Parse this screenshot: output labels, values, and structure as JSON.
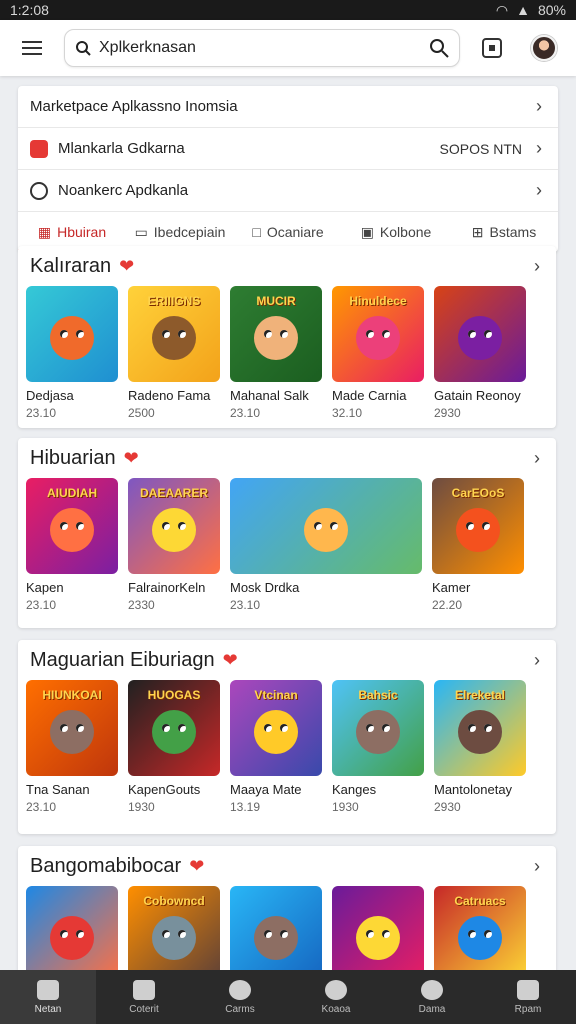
{
  "status": {
    "time": "1:2:08",
    "battery": "80%"
  },
  "search": {
    "value": "Xplkerknasan"
  },
  "menu": [
    {
      "label": "Marketpace Aplkassno Inomsia",
      "meta": ""
    },
    {
      "label": "Mlankarla Gdkarna",
      "meta": "SOPOS NTN"
    },
    {
      "label": "Noankerc Apdkanla",
      "meta": ""
    }
  ],
  "tabs": [
    "Hbuiran",
    "Ibedcepiain",
    "Ocaniare",
    "Kolbone",
    "Bstams"
  ],
  "sections": [
    {
      "title": "Kalıraran",
      "apps": [
        {
          "name": "Dedjasa",
          "size": "23.10",
          "colors": [
            "#35c9d6",
            "#1f8fd1"
          ],
          "face": "#f06a2b",
          "banner": ""
        },
        {
          "name": "Radeno Fama",
          "size": "2500",
          "colors": [
            "#ffd23a",
            "#f3a21a"
          ],
          "face": "#8d5a2b",
          "banner": "ERIIIGNS"
        },
        {
          "name": "Mahanal Salk",
          "size": "23.10",
          "colors": [
            "#2e7d32",
            "#1b5e20"
          ],
          "face": "#f0b27a",
          "banner": "MUCIR"
        },
        {
          "name": "Made Carnia",
          "size": "32.10",
          "colors": [
            "#ff9800",
            "#e91e63"
          ],
          "face": "#ec407a",
          "banner": "Hinuldece"
        },
        {
          "name": "Gatain Reonoy",
          "size": "2930",
          "colors": [
            "#d84315",
            "#6a1b9a"
          ],
          "face": "#7b1fa2",
          "banner": ""
        }
      ]
    },
    {
      "title": "Hibuarian",
      "apps": [
        {
          "name": "Kapen",
          "size": "23.10",
          "colors": [
            "#e91e63",
            "#7b1fa2"
          ],
          "face": "#ff7043",
          "banner": "AIUDIAH"
        },
        {
          "name": "FalrainorKeln",
          "size": "2330",
          "colors": [
            "#7e57c2",
            "#ff7043"
          ],
          "face": "#fdd835",
          "banner": "DAEAARER"
        },
        {
          "name": "Mosk Drdka",
          "size": "23.10",
          "colors": [
            "#42a5f5",
            "#66bb6a"
          ],
          "face": "#ffb74d",
          "banner": "",
          "wide": true
        },
        {
          "name": "Kamer",
          "size": "22.20",
          "colors": [
            "#6d4c41",
            "#ff8f00"
          ],
          "face": "#f4511e",
          "banner": "CarEOoS"
        }
      ]
    },
    {
      "title": "Maguarian Eiburiagn",
      "apps": [
        {
          "name": "Tna Sanan",
          "size": "23.10",
          "colors": [
            "#ff6f00",
            "#bf360c"
          ],
          "face": "#8d6e63",
          "banner": "HIUNKOAI"
        },
        {
          "name": "KapenGouts",
          "size": "1930",
          "colors": [
            "#212121",
            "#c62828"
          ],
          "face": "#43a047",
          "banner": "HUOGAS"
        },
        {
          "name": "Maaya Mate",
          "size": "13.19",
          "colors": [
            "#ab47bc",
            "#3949ab"
          ],
          "face": "#ffca28",
          "banner": "Vtcinan"
        },
        {
          "name": "Kanges",
          "size": "1930",
          "colors": [
            "#4fc3f7",
            "#43a047"
          ],
          "face": "#8d6e63",
          "banner": "Bahsic"
        },
        {
          "name": "Mantolonetay",
          "size": "2930",
          "colors": [
            "#29b6f6",
            "#ffca28"
          ],
          "face": "#6d4c41",
          "banner": "Elreketal"
        }
      ]
    },
    {
      "title": "Bangomabibocar",
      "apps": [
        {
          "name": "",
          "size": "",
          "colors": [
            "#1e88e5",
            "#ff7043"
          ],
          "face": "#e53935",
          "banner": ""
        },
        {
          "name": "",
          "size": "",
          "colors": [
            "#ff8f00",
            "#5d4037"
          ],
          "face": "#78909c",
          "banner": "Cobowncd"
        },
        {
          "name": "",
          "size": "",
          "colors": [
            "#29b6f6",
            "#1565c0"
          ],
          "face": "#8d6e63",
          "banner": ""
        },
        {
          "name": "",
          "size": "",
          "colors": [
            "#6a1b9a",
            "#e91e63"
          ],
          "face": "#fdd835",
          "banner": ""
        },
        {
          "name": "",
          "size": "",
          "colors": [
            "#c62828",
            "#fdd835"
          ],
          "face": "#1e88e5",
          "banner": "Catruacs"
        }
      ]
    }
  ],
  "bottom_nav": [
    "Netan",
    "Coterit",
    "Carms",
    "Koaoa",
    "Dama",
    "Rpam"
  ]
}
